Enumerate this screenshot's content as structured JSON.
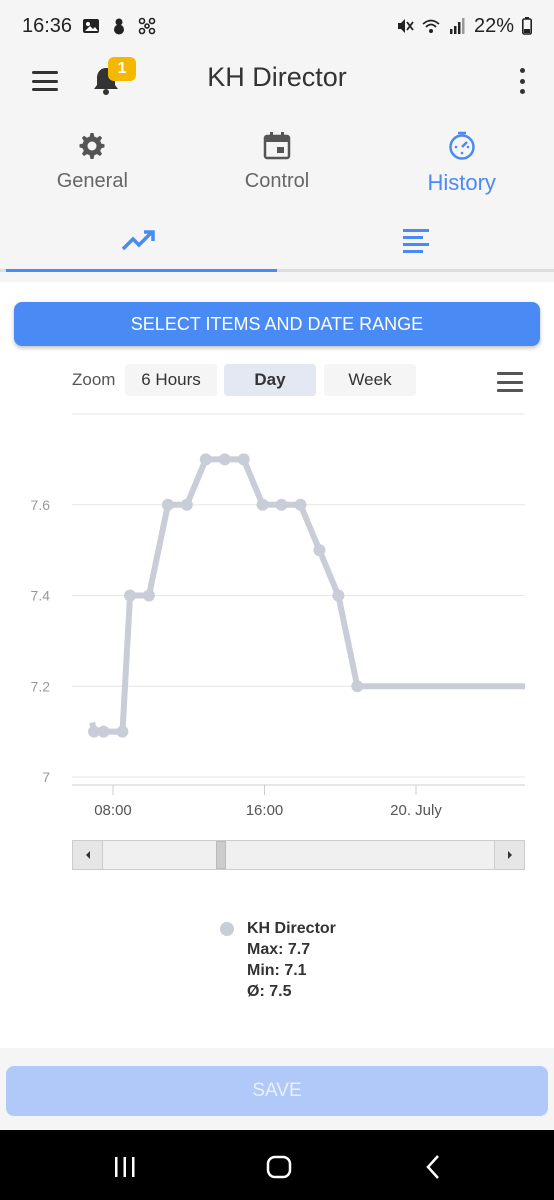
{
  "status_bar": {
    "time": "16:36",
    "battery": "22%"
  },
  "app_bar": {
    "title": "KH Director",
    "notification_count": "1"
  },
  "main_tabs": [
    {
      "label": "General",
      "icon": "gear-icon",
      "active": false
    },
    {
      "label": "Control",
      "icon": "calendar-icon",
      "active": false
    },
    {
      "label": "History",
      "icon": "history-icon",
      "active": true
    }
  ],
  "sub_tabs": [
    {
      "icon": "trend-chart-icon",
      "active": true
    },
    {
      "icon": "list-lines-icon",
      "active": false
    }
  ],
  "select_button": "SELECT ITEMS AND DATE RANGE",
  "zoom": {
    "label": "Zoom",
    "options": [
      "6 Hours",
      "Day",
      "Week"
    ],
    "selected": "Day"
  },
  "chart_data": {
    "type": "line",
    "series": [
      {
        "name": "KH Director",
        "color": "#c8cdd8",
        "points": [
          [
            6.9,
            7.12
          ],
          [
            7.0,
            7.1
          ],
          [
            7.5,
            7.1
          ],
          [
            8.5,
            7.1
          ],
          [
            8.9,
            7.4
          ],
          [
            9.9,
            7.4
          ],
          [
            10.9,
            7.6
          ],
          [
            11.9,
            7.6
          ],
          [
            12.9,
            7.7
          ],
          [
            13.9,
            7.7
          ],
          [
            14.9,
            7.7
          ],
          [
            15.9,
            7.6
          ],
          [
            16.9,
            7.6
          ],
          [
            17.9,
            7.6
          ],
          [
            18.9,
            7.5
          ],
          [
            19.9,
            7.4
          ],
          [
            20.9,
            7.2
          ],
          [
            30.5,
            7.2
          ]
        ]
      }
    ],
    "y_ticks": [
      "7",
      "7.2",
      "7.4",
      "7.6"
    ],
    "x_ticks": [
      "08:00",
      "16:00",
      "20. July"
    ],
    "ylim": [
      7.0,
      7.8
    ],
    "grid": true
  },
  "legend": {
    "name": "KH Director",
    "max": "Max: 7.7",
    "min": "Min: 7.1",
    "avg": "Ø: 7.5"
  },
  "save_button": "SAVE"
}
